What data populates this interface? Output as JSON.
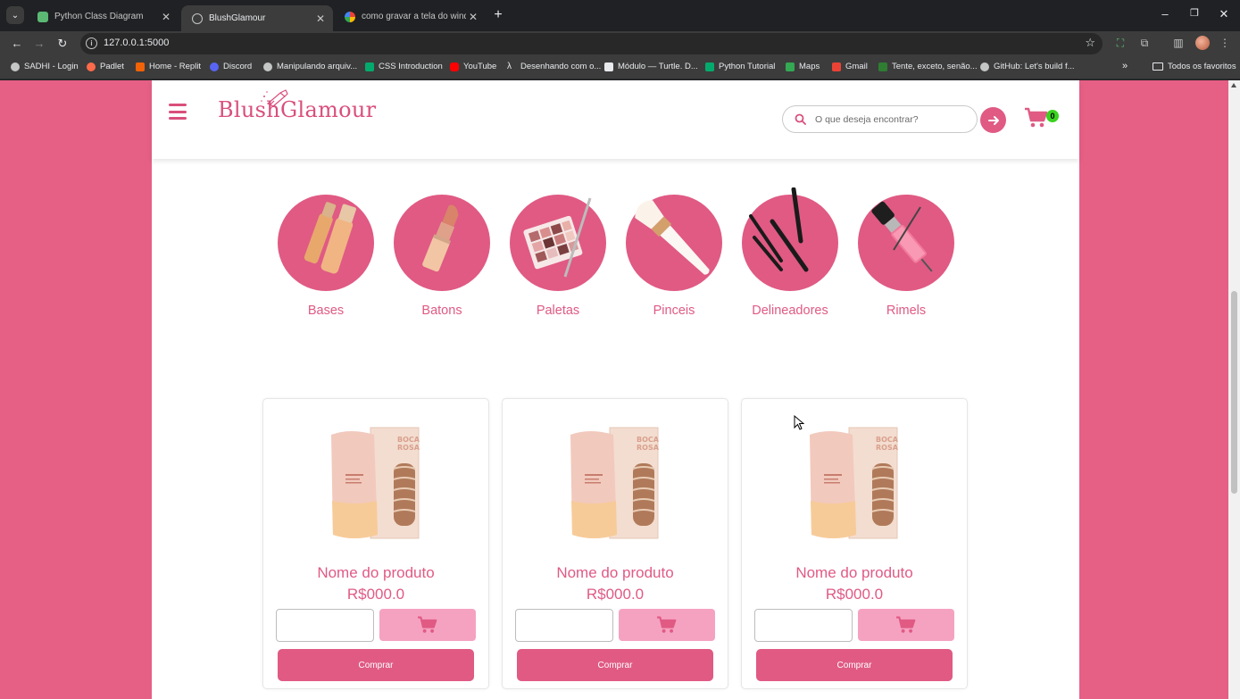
{
  "browser": {
    "tabs": [
      {
        "title": "Python Class Diagram",
        "active": false
      },
      {
        "title": "BlushGlamour",
        "active": true
      },
      {
        "title": "como gravar a tela do windows",
        "active": false
      }
    ],
    "new_tab": "+",
    "window_controls": {
      "minimize": "–",
      "restore": "❐",
      "close": "✕"
    },
    "url": "127.0.0.1:5000",
    "bookmarks": [
      "SADHI - Login",
      "Padlet",
      "Home - Replit",
      "Discord",
      "Manipulando arquiv...",
      "CSS Introduction",
      "YouTube",
      "Desenhando com o...",
      "Módulo — Turtle. D...",
      "Python Tutorial",
      "Maps",
      "Gmail",
      "Tente, exceto, senão...",
      "GitHub: Let's build f..."
    ],
    "bookmarks_more": "»",
    "all_bookmarks": "Todos os favoritos"
  },
  "site": {
    "logo": "BlushGlamour",
    "search_placeholder": "O que deseja encontrar?",
    "cart_count": "0",
    "colors": {
      "brand": "#e05a84",
      "background": "#e65f85",
      "cart_button": "#f5a2c1",
      "badge": "#3ad21f"
    },
    "categories": [
      {
        "label": "Bases",
        "icon": "foundation-icon"
      },
      {
        "label": "Batons",
        "icon": "lipstick-icon"
      },
      {
        "label": "Paletas",
        "icon": "palette-icon"
      },
      {
        "label": "Pinceis",
        "icon": "brush-icon"
      },
      {
        "label": "Delineadores",
        "icon": "eyeliner-icon"
      },
      {
        "label": "Rimels",
        "icon": "mascara-icon"
      }
    ],
    "products": [
      {
        "name": "Nome do produto",
        "price": "R$000.0",
        "buy_label": "Comprar"
      },
      {
        "name": "Nome do produto",
        "price": "R$000.0",
        "buy_label": "Comprar"
      },
      {
        "name": "Nome do produto",
        "price": "R$000.0",
        "buy_label": "Comprar"
      }
    ]
  }
}
